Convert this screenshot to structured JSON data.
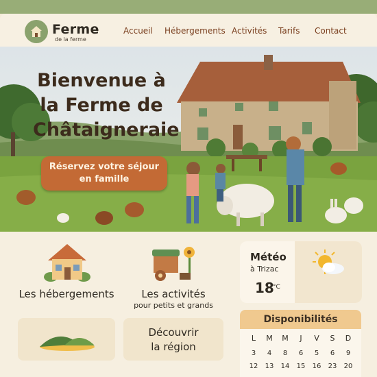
{
  "header": {
    "brand_title": "Ferme",
    "brand_subtitle": "de la ferme",
    "nav": [
      "Accueil",
      "Hébergements",
      "Activités",
      "Tarifs",
      "Contact"
    ]
  },
  "hero": {
    "title_lines": [
      "Bienvenue à",
      "la Ferme de",
      "Châtaigneraie"
    ],
    "cta_lines": [
      "Réservez votre séjour",
      "en famille"
    ]
  },
  "cards": {
    "lodging_label": "Les hébergements",
    "activities_label": "Les activités",
    "activities_sub": "pour petits et grands",
    "discover_lines": [
      "Découvrir",
      "la région"
    ]
  },
  "weather": {
    "title": "Météo",
    "location": "à Trizac",
    "temp": "18",
    "unit": "°C"
  },
  "availability": {
    "title": "Disponibilités",
    "days": [
      "L",
      "M",
      "M",
      "J",
      "V",
      "S",
      "D"
    ],
    "row1": [
      "3",
      "4",
      "8",
      "6",
      "5",
      "6",
      "9"
    ],
    "row2": [
      "12",
      "13",
      "14",
      "15",
      "16",
      "23",
      "20"
    ]
  },
  "colors": {
    "accent": "#c36a35",
    "nav_text": "#7a3f1f",
    "top_strip": "#98ad77",
    "availability_header": "#f0c98f"
  }
}
